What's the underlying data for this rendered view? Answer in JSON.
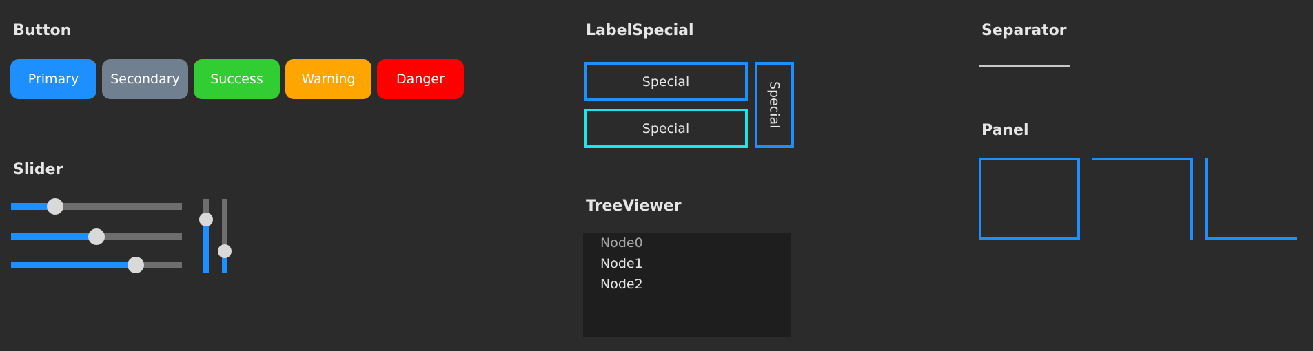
{
  "sections": {
    "button": "Button",
    "slider": "Slider",
    "label_special": "LabelSpecial",
    "tree_viewer": "TreeViewer",
    "separator": "Separator",
    "panel": "Panel"
  },
  "buttons": {
    "primary": {
      "label": "Primary",
      "color": "#1e8fff"
    },
    "secondary": {
      "label": "Secondary",
      "color": "#708090"
    },
    "success": {
      "label": "Success",
      "color": "#32cd32"
    },
    "warning": {
      "label": "Warning",
      "color": "#ffa500"
    },
    "danger": {
      "label": "Danger",
      "color": "#ff0000"
    }
  },
  "sliders": {
    "horizontal": [
      0.26,
      0.5,
      0.73
    ],
    "vertical": [
      0.72,
      0.3
    ]
  },
  "label_special": {
    "box1": "Special",
    "box2": "Special",
    "vertical": "Special"
  },
  "tree": {
    "nodes": [
      "Node0",
      "Node1",
      "Node2"
    ],
    "selected_index": 0
  },
  "colors": {
    "accent": "#1e8fff",
    "cyan": "#1ee6e6",
    "background": "#2b2b2b",
    "tree_background": "#1e1e1e"
  }
}
